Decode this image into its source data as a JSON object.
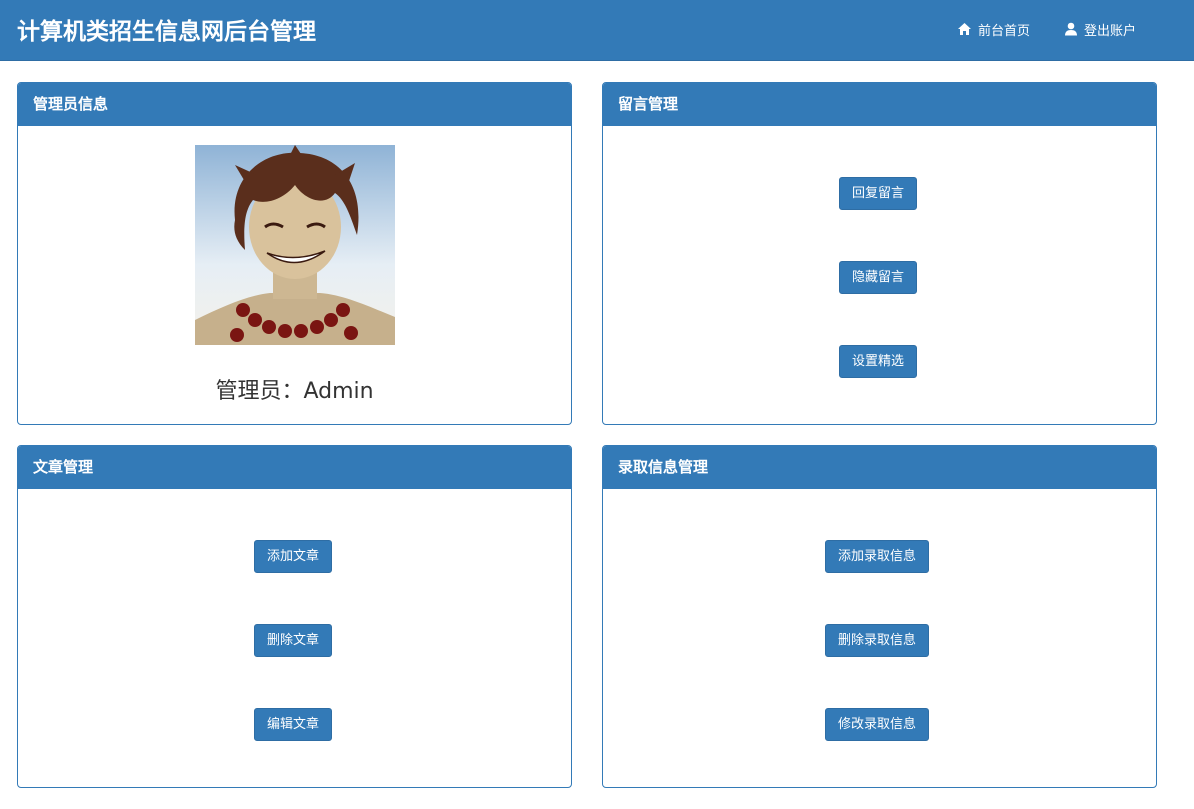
{
  "header": {
    "title": "计算机类招生信息网后台管理",
    "home_label": "前台首页",
    "logout_label": "登出账户",
    "home_icon": "home-icon",
    "user_icon": "user-icon"
  },
  "panels": {
    "admin": {
      "title": "管理员信息",
      "name_text": "管理员：Admin"
    },
    "messages": {
      "title": "留言管理",
      "buttons": [
        "回复留言",
        "隐藏留言",
        "设置精选"
      ]
    },
    "articles": {
      "title": "文章管理",
      "buttons": [
        "添加文章",
        "删除文章",
        "编辑文章"
      ]
    },
    "admissions": {
      "title": "录取信息管理",
      "buttons": [
        "添加录取信息",
        "删除录取信息",
        "修改录取信息"
      ]
    }
  },
  "colors": {
    "primary": "#337ab7",
    "primary_border": "#2e6da4"
  }
}
